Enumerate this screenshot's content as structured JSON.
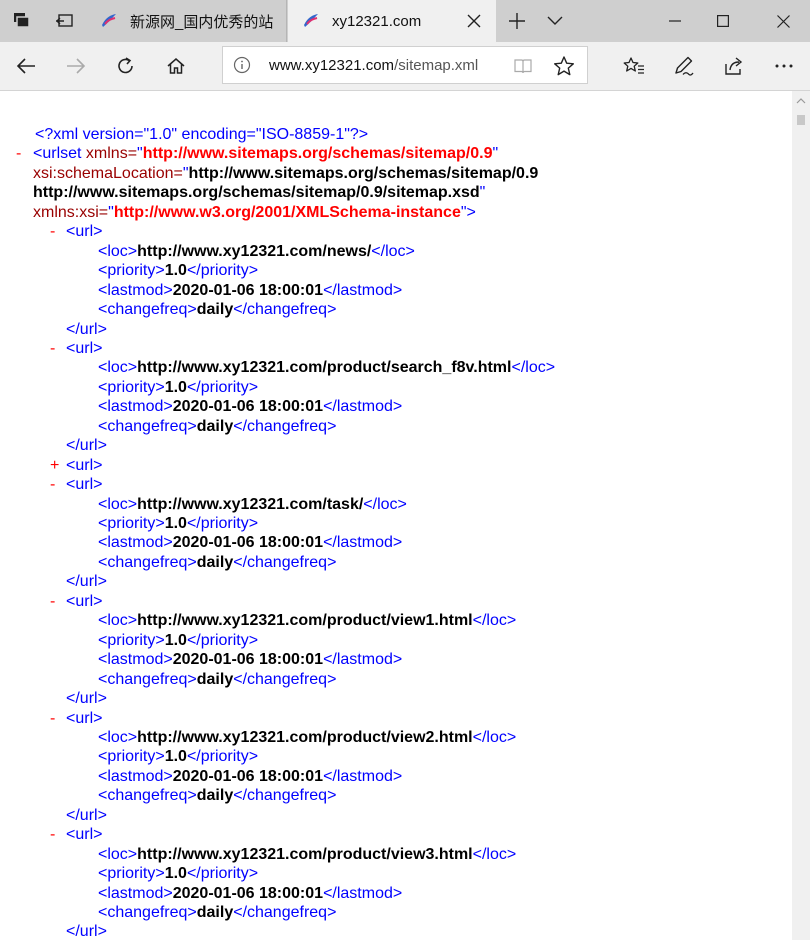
{
  "tabs": [
    {
      "title": "新源网_国内优秀的站",
      "active": false
    },
    {
      "title": "xy12321.com",
      "active": true
    }
  ],
  "address": {
    "host": "www.xy12321.com",
    "path": "/sitemap.xml"
  },
  "xml": {
    "declaration": "<?xml version=\"1.0\" encoding=\"ISO-8859-1\"?>",
    "urlset_open": "<urlset",
    "xmlns_attr": "xmlns=",
    "xmlns_value": "http://www.sitemaps.org/schemas/sitemap/0.9",
    "schema_attr": "xsi:schemaLocation=",
    "schema_value_1": "http://www.sitemaps.org/schemas/sitemap/0.9",
    "schema_value_2": "http://www.sitemaps.org/schemas/sitemap/0.9/sitemap.xsd",
    "xsi_attr": "xmlns:xsi=",
    "xsi_value": "http://www.w3.org/2001/XMLSchema-instance",
    "quote": "\"",
    "close_bracket": ">",
    "expanded_marker": "-",
    "collapsed_marker": "+",
    "tag_url_open": "<url>",
    "tag_url_close": "</url>",
    "tag_loc_open": "<loc>",
    "tag_loc_close": "</loc>",
    "tag_priority_open": "<priority>",
    "tag_priority_close": "</priority>",
    "tag_lastmod_open": "<lastmod>",
    "tag_lastmod_close": "</lastmod>",
    "tag_changefreq_open": "<changefreq>",
    "tag_changefreq_close": "</changefreq>",
    "urls": [
      {
        "loc": "http://www.xy12321.com/news/",
        "priority": "1.0",
        "lastmod": "2020-01-06 18:00:01",
        "changefreq": "daily"
      },
      {
        "loc": "http://www.xy12321.com/product/search_f8v.html",
        "priority": "1.0",
        "lastmod": "2020-01-06 18:00:01",
        "changefreq": "daily"
      },
      {
        "collapsed": true
      },
      {
        "loc": "http://www.xy12321.com/task/",
        "priority": "1.0",
        "lastmod": "2020-01-06 18:00:01",
        "changefreq": "daily"
      },
      {
        "loc": "http://www.xy12321.com/product/view1.html",
        "priority": "1.0",
        "lastmod": "2020-01-06 18:00:01",
        "changefreq": "daily"
      },
      {
        "loc": "http://www.xy12321.com/product/view2.html",
        "priority": "1.0",
        "lastmod": "2020-01-06 18:00:01",
        "changefreq": "daily"
      },
      {
        "loc": "http://www.xy12321.com/product/view3.html",
        "priority": "1.0",
        "lastmod": "2020-01-06 18:00:01",
        "changefreq": "daily"
      }
    ]
  },
  "colors": {
    "tag": "#990000",
    "bracket": "#0000ff",
    "attr_value": "#ff0000",
    "text": "#000000"
  }
}
